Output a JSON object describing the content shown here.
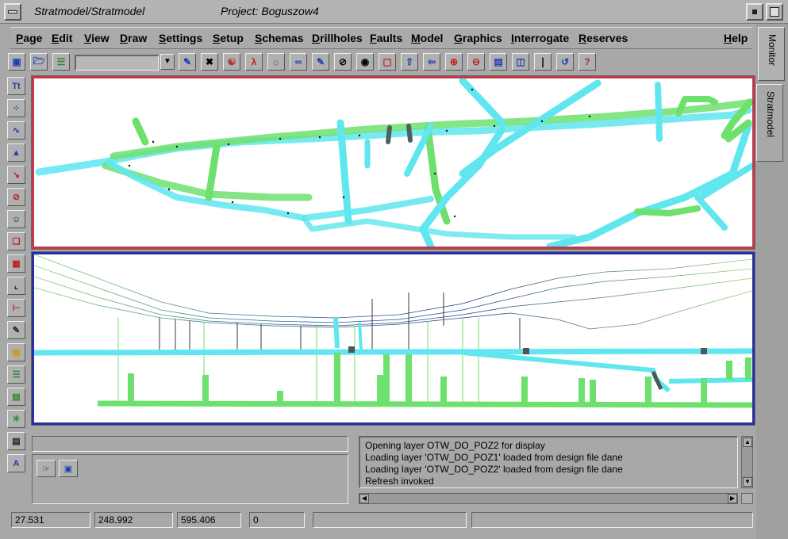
{
  "window": {
    "app_title": "Stratmodel/Stratmodel",
    "project_label": "Project: Boguszow4"
  },
  "menu": {
    "items": [
      "Page",
      "Edit",
      "View",
      "Draw",
      "Settings",
      "Setup",
      "Schemas",
      "Drillholes",
      "Faults",
      "Model",
      "Graphics",
      "Interrogate",
      "Reserves"
    ],
    "help": "Help"
  },
  "toolbar": {
    "layer_select_value": "",
    "icons": [
      "open-map-icon",
      "open-folder-icon",
      "layers-icon",
      "pencil-icon",
      "cross-tools-icon",
      "globe-icon",
      "pdf-icon",
      "lightbulb-icon",
      "binoculars-icon",
      "paint-icon",
      "hide-eye-icon",
      "show-eye-icon",
      "fit-window-icon",
      "export-icon",
      "import-icon",
      "zoom-in-icon",
      "zoom-out-icon",
      "horizontal-split-icon",
      "vertical-split-icon",
      "section-line-icon",
      "refresh-icon",
      "help-cursor-icon"
    ]
  },
  "left_tools": {
    "icons": [
      "text-tool-icon",
      "points-tool-icon",
      "polyline-tool-icon",
      "fill-tool-icon",
      "arrow-select-icon",
      "measure-icon",
      "pointer-icon",
      "box-select-icon",
      "box-add-icon",
      "corner-icon",
      "line-icon",
      "edit-icon",
      "pattern-icon",
      "hatch-icon",
      "stack-icon",
      "snap-icon",
      "document-icon",
      "letter-a-icon"
    ]
  },
  "log": {
    "lines": [
      "Opening layer OTW_DO_POZ2 for display",
      "Loading layer 'OTW_DO_POZ1' loaded from design file dane",
      "Loading layer 'OTW_DO_POZ2' loaded from design file dane",
      "Refresh invoked"
    ]
  },
  "status": {
    "x": "27.531",
    "y": "248.992",
    "z": "595.406",
    "count": "0",
    "field5": "",
    "field6": ""
  },
  "side_tabs": {
    "monitor": "Monitor",
    "stratmodel": "Stratmodel"
  },
  "colors": {
    "plan_border": "#c23a4a",
    "section_border": "#2b2fa0",
    "tunnel_cyan": "#5fe6ee",
    "tunnel_green": "#6ee06e",
    "mesh": "#3a9a8a"
  }
}
